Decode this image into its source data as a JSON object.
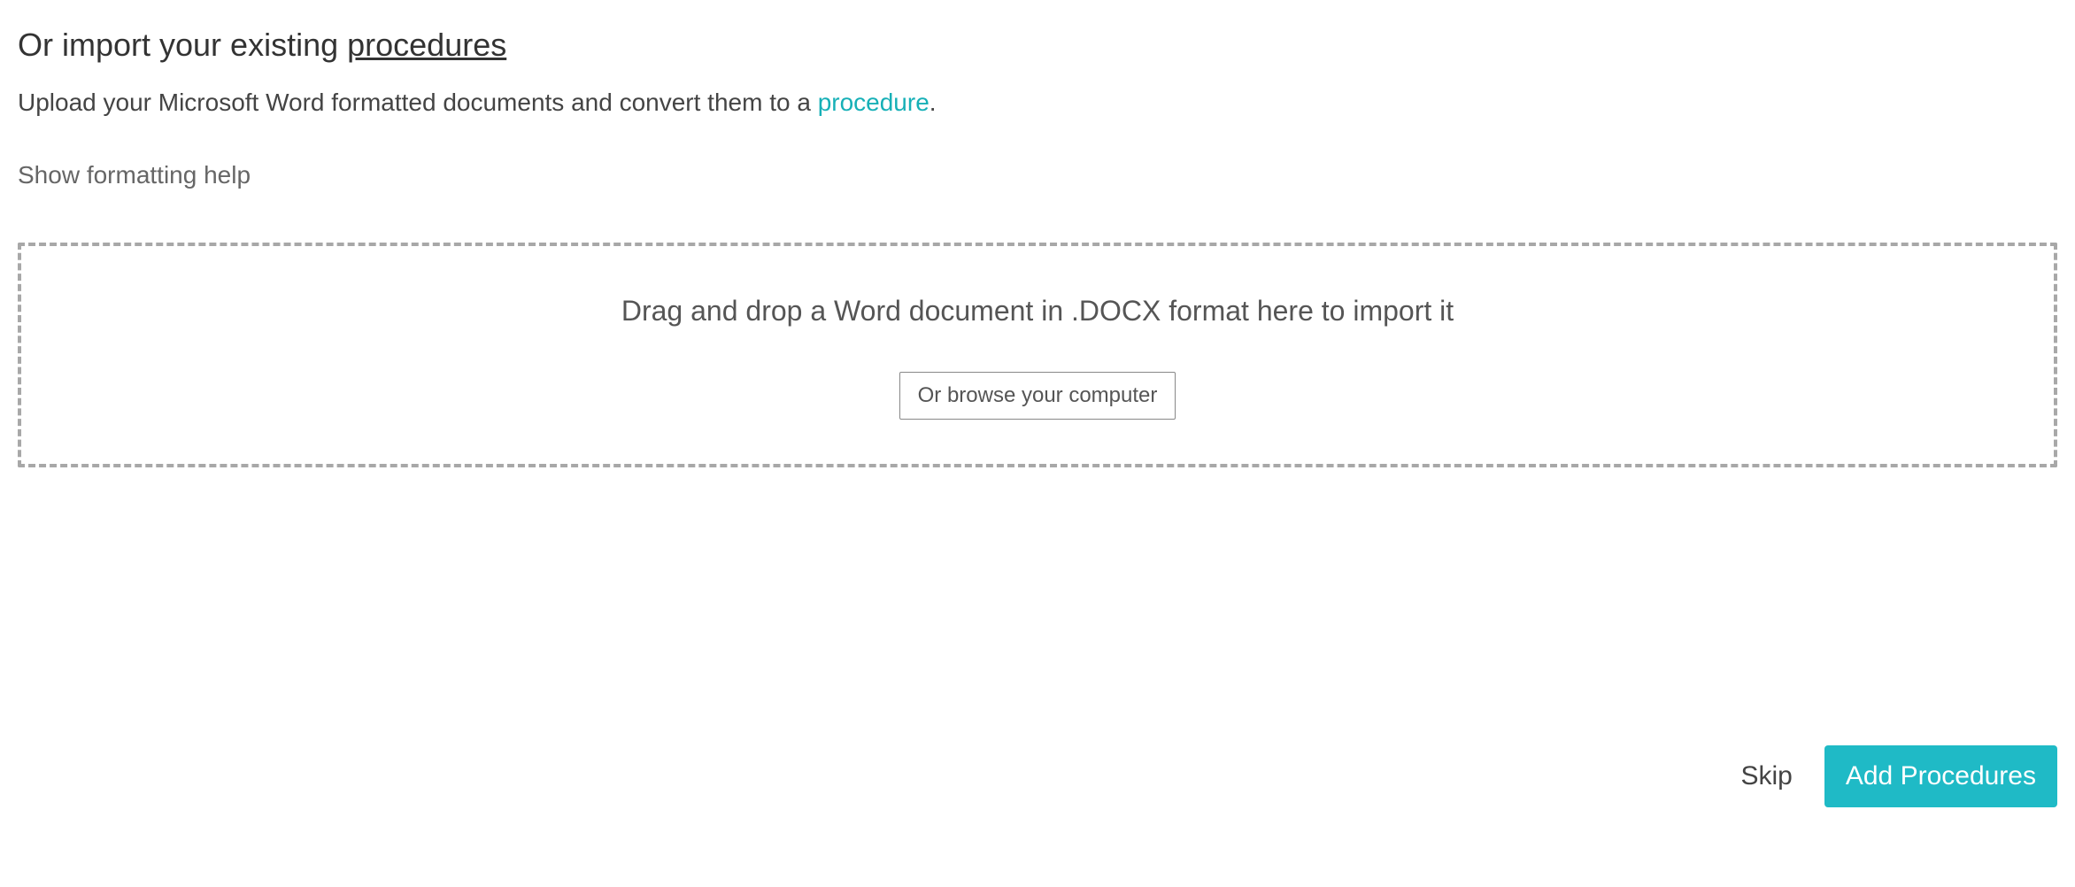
{
  "heading": {
    "prefix": "Or import your existing ",
    "underlined": "procedures"
  },
  "subtext": {
    "prefix": "Upload your Microsoft Word formatted documents and convert them to a ",
    "link": "procedure",
    "suffix": "."
  },
  "help_link": "Show formatting help",
  "dropzone": {
    "text": "Drag and drop a Word document in .DOCX format here to import it",
    "browse_label": "Or browse your computer"
  },
  "footer": {
    "skip_label": "Skip",
    "add_label": "Add Procedures"
  }
}
